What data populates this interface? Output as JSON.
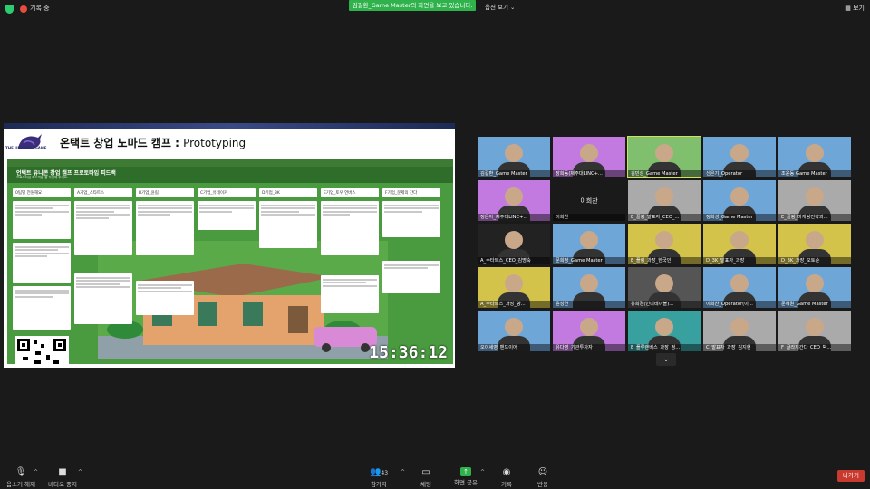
{
  "topbar": {
    "recording_label": "기록 중",
    "share_banner": "김길환_Game Master의 화면을 보고 있습니다.",
    "view_options": "옵션 보기 ⌄",
    "view_button": "보기"
  },
  "shared_screen": {
    "slide_logo_text": "THE UNICORN GAME",
    "slide_title_ko": "온택트 창업 노마드 캠프 : ",
    "slide_title_en": "Prototyping",
    "board_title": "언택트 유니콘 창업 캠프 프로토타입 피드백",
    "board_subtitle": "프로토타입 피드백을 잘 작성해 주세요.",
    "columns": [
      "0팀별 전원해요",
      "A기업_스타트스",
      "B기업_윤림",
      "C기업_유테이커",
      "D기업_3K",
      "E기업_토우 언버스",
      "F기업_문제의 간다"
    ],
    "timer": "15:36:12"
  },
  "participants": [
    {
      "name": "김길환_Game Master",
      "color": "#6fa6d8"
    },
    {
      "name": "장희동(제주대LINC+...",
      "color": "#c37ae0"
    },
    {
      "name": "김민성_Game Master",
      "color": "#7fbf6e",
      "active": true
    },
    {
      "name": "신은기_Operator",
      "color": "#6fa6d8"
    },
    {
      "name": "조윤동 Game Master",
      "color": "#6fa6d8"
    },
    {
      "name": "정은아_제주대LINC+...",
      "color": "#c37ae0"
    },
    {
      "name": "이희찬",
      "color": "#1a1a1a",
      "no_video": true
    },
    {
      "name": "E_플링_발표자_CEO_...",
      "color": "#aaa"
    },
    {
      "name": "정희성_Game Master",
      "color": "#6fa6d8"
    },
    {
      "name": "E_플링_마케팅전략과...",
      "color": "#aaa"
    },
    {
      "name": "A_수타트스_CEO_김명숙",
      "color": "#222"
    },
    {
      "name": "문희정_Game Master",
      "color": "#6fa6d8"
    },
    {
      "name": "E_플링_과장_한국인",
      "color": "#d4c34a"
    },
    {
      "name": "D_3K_발표자_과장",
      "color": "#d4c34a"
    },
    {
      "name": "D_3K_과장_오토순",
      "color": "#d4c34a"
    },
    {
      "name": "A_수타트스_과장_항...",
      "color": "#d4c34a"
    },
    {
      "name": "윤성연",
      "color": "#6fa6d8"
    },
    {
      "name": "유희경(인디테이블)...",
      "color": "#555"
    },
    {
      "name": "이희찬_Operator(이...",
      "color": "#6fa6d8"
    },
    {
      "name": "문혜원_Game Master",
      "color": "#6fa6d8"
    },
    {
      "name": "오이세영_밴드이어",
      "color": "#6fa6d8"
    },
    {
      "name": "유다영_기관투자자",
      "color": "#c37ae0"
    },
    {
      "name": "E_플루랜버스_과장_정...",
      "color": "#39a0a0"
    },
    {
      "name": "C_발표자_과장_김지현",
      "color": "#aaa"
    },
    {
      "name": "F_글라지간다_CEO_박...",
      "color": "#aaa"
    }
  ],
  "toolbar": {
    "mute_label": "음소거 해제",
    "video_label": "비디오 중지",
    "participants_label": "참가자",
    "participants_count": "43",
    "chat_label": "채팅",
    "share_label": "화면 공유",
    "record_label": "기록",
    "reactions_label": "반응",
    "leave_label": "나가기"
  }
}
